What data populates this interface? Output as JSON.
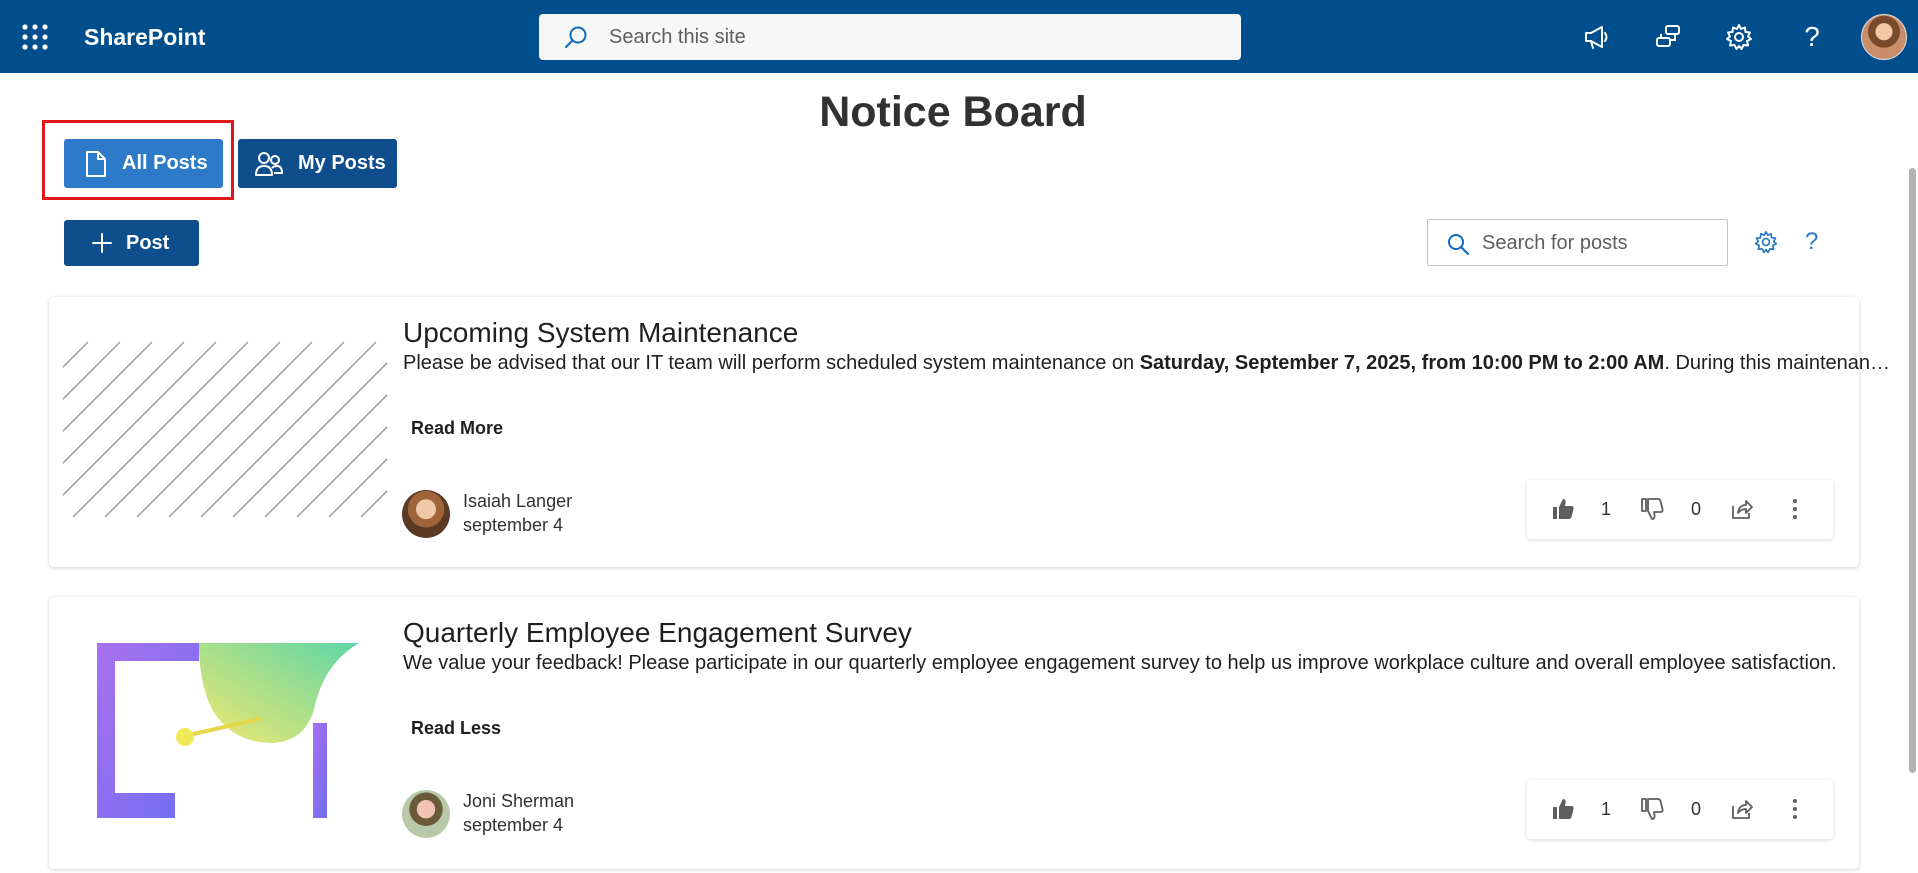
{
  "suite": {
    "app_name": "SharePoint",
    "search_placeholder": "Search this site"
  },
  "page": {
    "title": "Notice Board"
  },
  "tabs": {
    "all_posts": "All Posts",
    "my_posts": "My Posts"
  },
  "toolbar": {
    "new_post": "Post",
    "search_placeholder": "Search for posts",
    "help_symbol": "?"
  },
  "posts": [
    {
      "title": "Upcoming System Maintenance",
      "body_prefix": "Please be advised that our IT team will perform scheduled system maintenance on ",
      "body_bold": "Saturday, September 7, 2025, from 10:00 PM to 2:00 AM",
      "body_suffix": ". During this maintenance window, certain systems and services may be unavailable.",
      "read_toggle": "Read More",
      "author": "Isaiah Langer",
      "date": "september 4",
      "likes": "1",
      "dislikes": "0"
    },
    {
      "title": "Quarterly Employee Engagement Survey",
      "body_prefix": "We value your feedback! Please participate in our quarterly employee engagement survey to help us improve workplace culture and overall employee satisfaction.",
      "read_toggle": "Read Less",
      "author": "Joni Sherman",
      "date": "september 4",
      "likes": "1",
      "dislikes": "0"
    }
  ],
  "colors": {
    "suite_bar": "#004e8c",
    "tab_active": "#2d7ac8",
    "button_primary": "#0f4e8c",
    "highlight": "#e3161b"
  }
}
